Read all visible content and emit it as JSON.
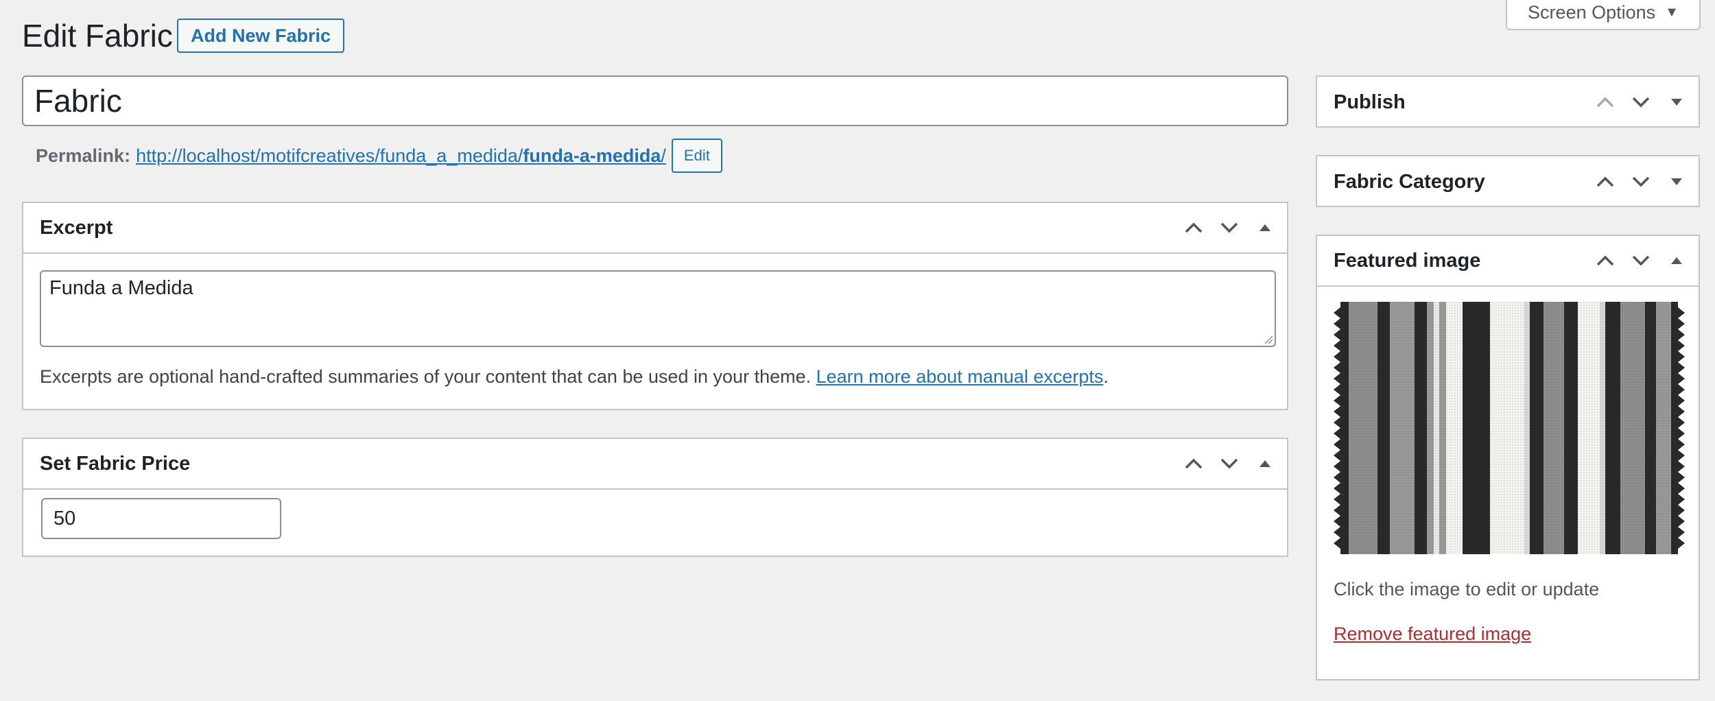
{
  "header": {
    "title": "Edit Fabric",
    "add_new_label": "Add New Fabric",
    "screen_options_label": "Screen Options"
  },
  "post": {
    "title_value": "Fabric",
    "permalink_label": "Permalink:",
    "permalink_base": "http://localhost/motifcreatives/funda_a_medida/",
    "permalink_slug": "funda-a-medida",
    "permalink_trailing": "/",
    "edit_label": "Edit"
  },
  "excerpt": {
    "title": "Excerpt",
    "value": "Funda a Medida",
    "help_text": "Excerpts are optional hand-crafted summaries of your content that can be used in your theme. ",
    "help_link": "Learn more about manual excerpts",
    "help_end": "."
  },
  "price": {
    "title": "Set Fabric Price",
    "value": "50"
  },
  "sidebar": {
    "publish_title": "Publish",
    "category_title": "Fabric Category",
    "featured_title": "Featured image",
    "featured_help": "Click the image to edit or update",
    "featured_remove": "Remove featured image"
  },
  "colors": {
    "accent": "#2271b1",
    "danger": "#b32d2e",
    "background": "#f0f0f1",
    "border": "#c3c4c7"
  },
  "icons": {
    "move_up": "chevron-up-icon",
    "move_down": "chevron-down-icon",
    "toggle": "caret-icon"
  }
}
